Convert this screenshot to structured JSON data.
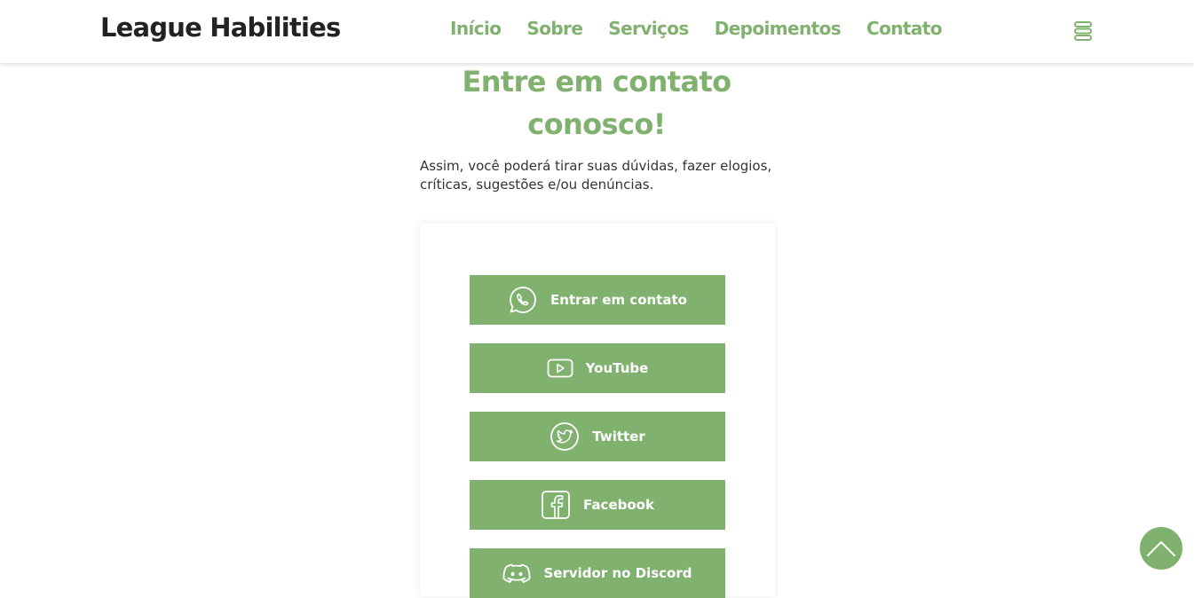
{
  "navbar": {
    "brand": "League Habilities",
    "links": [
      "Início",
      "Sobre",
      "Serviços",
      "Depoimentos",
      "Contato"
    ],
    "menu_icon": "stacked-bars-icon"
  },
  "contact": {
    "heading_line1": "Entre em contato",
    "heading_line2": "conosco!",
    "subtitle_line1": "Assim, você poderá tirar suas dúvidas, fazer elogios,",
    "subtitle_line2": "críticas, sugestões e/ou denúncias.",
    "buttons": [
      {
        "label": "Entrar em contato",
        "icon": "whatsapp-icon"
      },
      {
        "label": "YouTube",
        "icon": "youtube-icon"
      },
      {
        "label": "Twitter",
        "icon": "twitter-icon"
      },
      {
        "label": "Facebook",
        "icon": "facebook-icon"
      },
      {
        "label": "Servidor no Discord",
        "icon": "discord-icon"
      }
    ]
  },
  "back_to_top_icon": "chevron-up-icon",
  "colors": {
    "accent": "#81b16e",
    "brand_text": "#222222",
    "body_text": "#333333",
    "background": "#ffffff"
  }
}
